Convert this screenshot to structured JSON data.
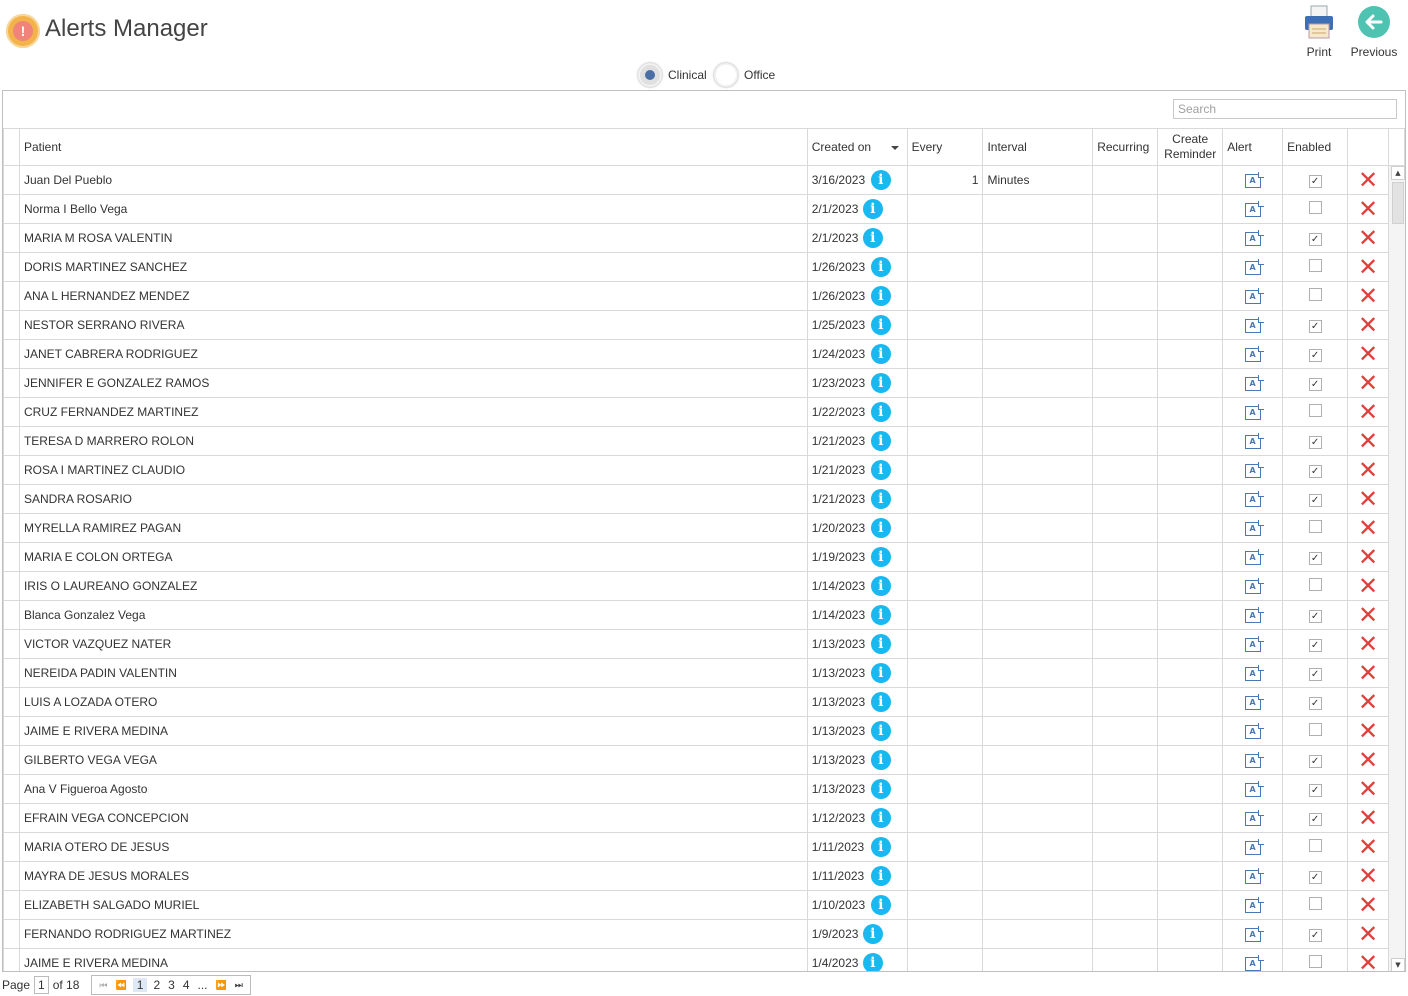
{
  "app": {
    "title": "Alerts Manager",
    "print_label": "Print",
    "previous_label": "Previous"
  },
  "filter": {
    "clinical_label": "Clinical",
    "office_label": "Office",
    "selected": "Clinical"
  },
  "search": {
    "placeholder": "Search"
  },
  "columns": {
    "patient": "Patient",
    "created_on": "Created on",
    "every": "Every",
    "interval": "Interval",
    "recurring": "Recurring",
    "create_reminder_1": "Create",
    "create_reminder_2": "Reminder",
    "alert": "Alert",
    "enabled": "Enabled"
  },
  "rows": [
    {
      "patient": "Juan Del Pueblo",
      "created": "3/16/2023",
      "every": "1",
      "interval": "Minutes",
      "enabled": true
    },
    {
      "patient": "Norma I Bello Vega",
      "created": "2/1/2023",
      "every": "",
      "interval": "",
      "enabled": false
    },
    {
      "patient": "MARIA M ROSA VALENTIN",
      "created": "2/1/2023",
      "every": "",
      "interval": "",
      "enabled": true
    },
    {
      "patient": "DORIS MARTINEZ SANCHEZ",
      "created": "1/26/2023",
      "every": "",
      "interval": "",
      "enabled": false
    },
    {
      "patient": "ANA L HERNANDEZ MENDEZ",
      "created": "1/26/2023",
      "every": "",
      "interval": "",
      "enabled": false
    },
    {
      "patient": "NESTOR SERRANO RIVERA",
      "created": "1/25/2023",
      "every": "",
      "interval": "",
      "enabled": true
    },
    {
      "patient": "JANET CABRERA  RODRIGUEZ",
      "created": "1/24/2023",
      "every": "",
      "interval": "",
      "enabled": true
    },
    {
      "patient": "JENNIFER E GONZALEZ RAMOS",
      "created": "1/23/2023",
      "every": "",
      "interval": "",
      "enabled": true
    },
    {
      "patient": "CRUZ FERNANDEZ MARTINEZ",
      "created": "1/22/2023",
      "every": "",
      "interval": "",
      "enabled": false
    },
    {
      "patient": "TERESA D MARRERO ROLON",
      "created": "1/21/2023",
      "every": "",
      "interval": "",
      "enabled": true
    },
    {
      "patient": "ROSA I MARTINEZ  CLAUDIO",
      "created": "1/21/2023",
      "every": "",
      "interval": "",
      "enabled": true
    },
    {
      "patient": "SANDRA ROSARIO",
      "created": "1/21/2023",
      "every": "",
      "interval": "",
      "enabled": true
    },
    {
      "patient": "MYRELLA RAMIREZ PAGAN",
      "created": "1/20/2023",
      "every": "",
      "interval": "",
      "enabled": false
    },
    {
      "patient": "MARIA E COLON ORTEGA",
      "created": "1/19/2023",
      "every": "",
      "interval": "",
      "enabled": true
    },
    {
      "patient": "IRIS O LAUREANO GONZALEZ",
      "created": "1/14/2023",
      "every": "",
      "interval": "",
      "enabled": false
    },
    {
      "patient": "Blanca Gonzalez Vega",
      "created": "1/14/2023",
      "every": "",
      "interval": "",
      "enabled": true
    },
    {
      "patient": "VICTOR VAZQUEZ NATER",
      "created": "1/13/2023",
      "every": "",
      "interval": "",
      "enabled": true
    },
    {
      "patient": "NEREIDA PADIN VALENTIN",
      "created": "1/13/2023",
      "every": "",
      "interval": "",
      "enabled": true
    },
    {
      "patient": "LUIS A LOZADA OTERO",
      "created": "1/13/2023",
      "every": "",
      "interval": "",
      "enabled": true
    },
    {
      "patient": "JAIME E RIVERA MEDINA",
      "created": "1/13/2023",
      "every": "",
      "interval": "",
      "enabled": false
    },
    {
      "patient": "GILBERTO VEGA VEGA",
      "created": "1/13/2023",
      "every": "",
      "interval": "",
      "enabled": true
    },
    {
      "patient": "Ana V Figueroa Agosto",
      "created": "1/13/2023",
      "every": "",
      "interval": "",
      "enabled": true
    },
    {
      "patient": "EFRAIN VEGA CONCEPCION",
      "created": "1/12/2023",
      "every": "",
      "interval": "",
      "enabled": true
    },
    {
      "patient": "MARIA OTERO DE JESUS",
      "created": "1/11/2023",
      "every": "",
      "interval": "",
      "enabled": false
    },
    {
      "patient": "MAYRA DE JESUS MORALES",
      "created": "1/11/2023",
      "every": "",
      "interval": "",
      "enabled": true
    },
    {
      "patient": "ELIZABETH SALGADO MURIEL",
      "created": "1/10/2023",
      "every": "",
      "interval": "",
      "enabled": false
    },
    {
      "patient": "FERNANDO RODRIGUEZ MARTINEZ",
      "created": "1/9/2023",
      "every": "",
      "interval": "",
      "enabled": true
    },
    {
      "patient": "JAIME E RIVERA MEDINA",
      "created": "1/4/2023",
      "every": "",
      "interval": "",
      "enabled": false
    }
  ],
  "pager": {
    "page_label": "Page",
    "current_page": "1",
    "of_label": "of 18",
    "pages": [
      "1",
      "2",
      "3",
      "4"
    ],
    "ellipsis": "..."
  },
  "icons": {
    "info": "info-icon",
    "alert": "alert-edit-icon",
    "delete": "delete-x-icon",
    "print": "printer-icon",
    "previous": "back-arrow-icon"
  },
  "colors": {
    "info_blue": "#19b8f0",
    "delete_red": "#e0403b",
    "radio_selected": "#4a6fa5",
    "logo_orange": "#f3b24a"
  }
}
